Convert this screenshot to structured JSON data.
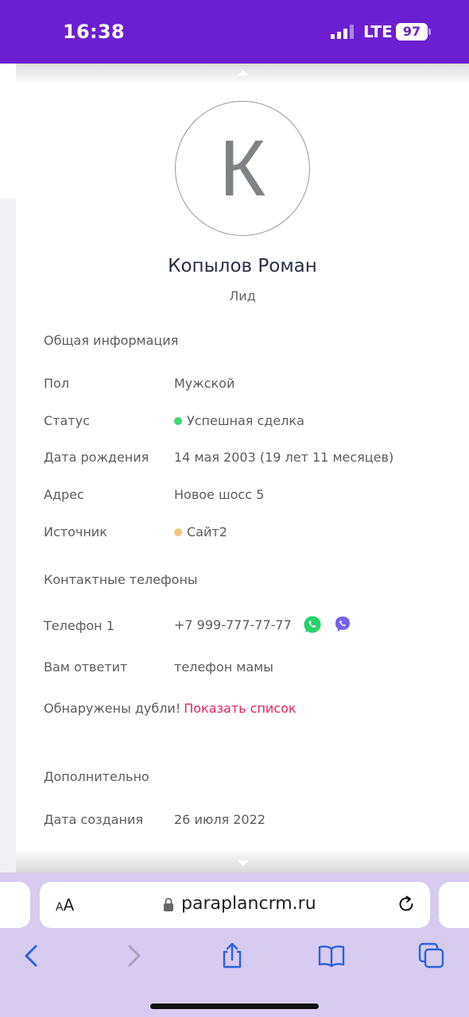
{
  "status_bar": {
    "time": "16:38",
    "network": "LTE",
    "battery": "97"
  },
  "profile": {
    "avatar_letter": "К",
    "name": "Копылов Роман",
    "role": "Лид"
  },
  "general": {
    "title": "Общая информация",
    "rows": [
      {
        "label": "Пол",
        "value": "Мужской"
      },
      {
        "label": "Статус",
        "value": "Успешная сделка",
        "dot_color": "#3ddc6e"
      },
      {
        "label": "Дата рождения",
        "value": "14 мая 2003 (19 лет 11 месяцев)"
      },
      {
        "label": "Адрес",
        "value": "Новое шосс 5"
      },
      {
        "label": "Источник",
        "value": "Сайт2",
        "dot_color": "#f6c77b"
      }
    ]
  },
  "contacts": {
    "title": "Контактные телефоны",
    "phone_label": "Телефон 1",
    "phone_value": "+7 999-777-77-77",
    "icons": [
      "whatsapp-icon",
      "viber-icon"
    ],
    "answer_label": "Вам ответит",
    "answer_value": "телефон мамы",
    "duplicates_text": "Обнаружены дубли!",
    "duplicates_link": "Показать список"
  },
  "additional": {
    "title": "Дополнительно",
    "created_label": "Дата создания",
    "created_value": "26 июля 2022"
  },
  "safari": {
    "aa_label": "AA",
    "url": "paraplancrm.ru",
    "accent": "#2a64d8"
  }
}
